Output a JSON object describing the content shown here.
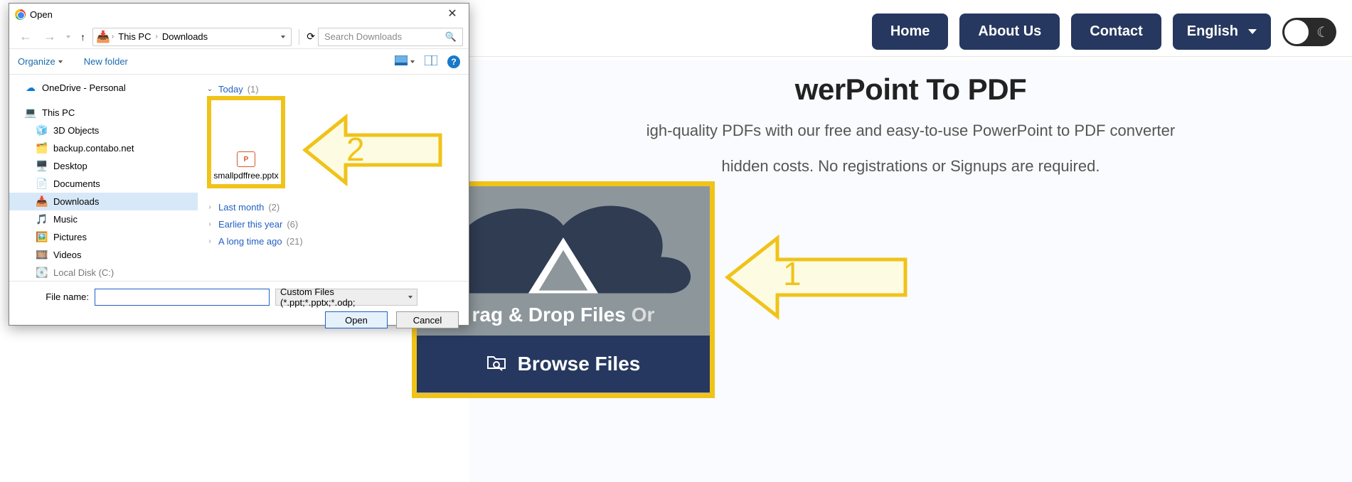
{
  "nav": {
    "home": "Home",
    "about": "About Us",
    "contact": "Contact",
    "lang": "English"
  },
  "hero": {
    "title": "werPoint To PDF",
    "line1": "igh-quality PDFs with our free and easy-to-use PowerPoint to PDF converter",
    "line2": "hidden costs. No registrations or Signups are required."
  },
  "uploader": {
    "drag": "rag & Drop Files",
    "or": "Or",
    "browse": "Browse Files"
  },
  "arrows": {
    "n1": "1",
    "n2": "2"
  },
  "dialog": {
    "title": "Open",
    "crumb1": "This PC",
    "crumb2": "Downloads",
    "search_ph": "Search Downloads",
    "organize": "Organize",
    "newfolder": "New folder",
    "tree": {
      "onedrive": "OneDrive - Personal",
      "thispc": "This PC",
      "_3d": "3D Objects",
      "backup": "backup.contabo.net",
      "desktop": "Desktop",
      "documents": "Documents",
      "downloads": "Downloads",
      "music": "Music",
      "pictures": "Pictures",
      "videos": "Videos",
      "local": "Local Disk (C:)"
    },
    "groups": {
      "today": "Today",
      "today_n": "(1)",
      "lastmonth": "Last month",
      "lastmonth_n": "(2)",
      "earlier": "Earlier this year",
      "earlier_n": "(6)",
      "longago": "A long time ago",
      "longago_n": "(21)"
    },
    "file": {
      "name": "smallpdffree.pptx"
    },
    "fnlabel": "File name:",
    "ftype": "Custom Files (*.ppt;*.pptx;*.odp;",
    "open": "Open",
    "cancel": "Cancel"
  }
}
